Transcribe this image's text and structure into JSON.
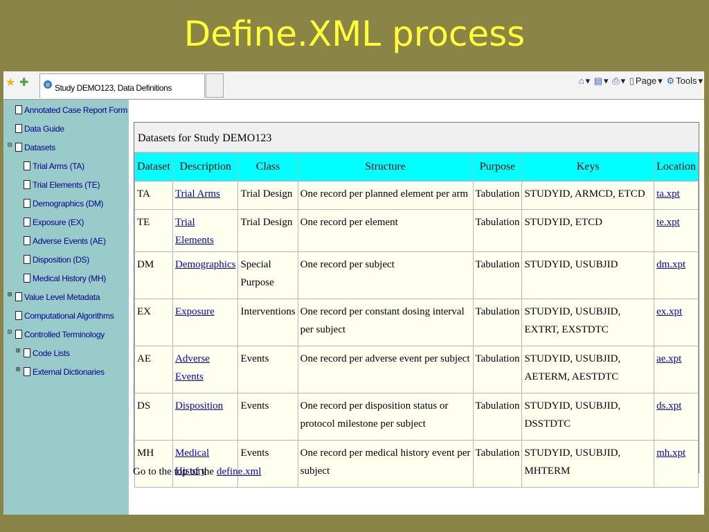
{
  "slide": {
    "title": "Define.XML process"
  },
  "browser": {
    "tab_title": "Study DEMO123, Data Definitions",
    "commands": {
      "page": "Page",
      "tools": "Tools"
    }
  },
  "sidebar": {
    "items": [
      {
        "label": "Annotated Case Report Form"
      },
      {
        "label": "Data Guide"
      },
      {
        "label": "Datasets"
      },
      {
        "label": "Trial Arms (TA)"
      },
      {
        "label": "Trial Elements (TE)"
      },
      {
        "label": "Demographics (DM)"
      },
      {
        "label": "Exposure (EX)"
      },
      {
        "label": "Adverse Events (AE)"
      },
      {
        "label": "Disposition (DS)"
      },
      {
        "label": "Medical History (MH)"
      },
      {
        "label": "Value Level Metadata"
      },
      {
        "label": "Computational Algorithms"
      },
      {
        "label": "Controlled Terminology"
      },
      {
        "label": "Code Lists"
      },
      {
        "label": "External Dictionaries"
      }
    ]
  },
  "table": {
    "caption": "Datasets for Study DEMO123",
    "headers": [
      "Dataset",
      "Description",
      "Class",
      "Structure",
      "Purpose",
      "Keys",
      "Location"
    ],
    "rows": [
      {
        "dataset": "TA",
        "description": "Trial Arms",
        "class": "Trial Design",
        "structure": "One record per planned element per arm",
        "purpose": "Tabulation",
        "keys": "STUDYID, ARMCD, ETCD",
        "location": "ta.xpt"
      },
      {
        "dataset": "TE",
        "description": "Trial Elements",
        "class": "Trial Design",
        "structure": "One record per element",
        "purpose": "Tabulation",
        "keys": "STUDYID, ETCD",
        "location": "te.xpt"
      },
      {
        "dataset": "DM",
        "description": "Demographics",
        "class": "Special Purpose",
        "structure": "One record per subject",
        "purpose": "Tabulation",
        "keys": "STUDYID, USUBJID",
        "location": "dm.xpt"
      },
      {
        "dataset": "EX",
        "description": "Exposure",
        "class": "Interventions",
        "structure": "One record per constant dosing interval per subject",
        "purpose": "Tabulation",
        "keys": "STUDYID, USUBJID, EXTRT, EXSTDTC",
        "location": "ex.xpt"
      },
      {
        "dataset": "AE",
        "description": "Adverse Events",
        "class": "Events",
        "structure": "One record per adverse event per subject",
        "purpose": "Tabulation",
        "keys": "STUDYID, USUBJID, AETERM, AESTDTC",
        "location": "ae.xpt"
      },
      {
        "dataset": "DS",
        "description": "Disposition",
        "class": "Events",
        "structure": "One record per disposition status or protocol milestone per subject",
        "purpose": "Tabulation",
        "keys": "STUDYID, USUBJID, DSSTDTC",
        "location": "ds.xpt"
      },
      {
        "dataset": "MH",
        "description": "Medical History",
        "class": "Events",
        "structure": "One record per medical history event per subject",
        "purpose": "Tabulation",
        "keys": "STUDYID, USUBJID, MHTERM",
        "location": "mh.xpt"
      }
    ]
  },
  "footer": {
    "prefix": "Go to the top of the ",
    "link": "define.xml"
  }
}
